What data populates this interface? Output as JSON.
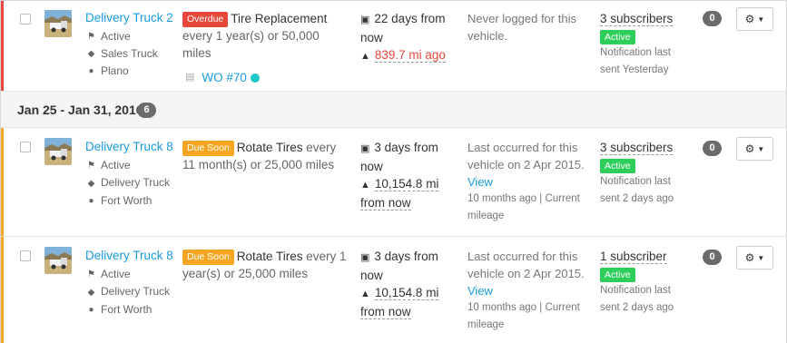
{
  "colors": {
    "overdue": "#e8473b",
    "due_soon": "#f5a623",
    "active": "#2dcf5a",
    "link": "#1a9be0"
  },
  "rows": [
    {
      "vehicle": {
        "name": "Delivery Truck 2",
        "status": "Active",
        "group": "Sales Truck",
        "location": "Plano"
      },
      "service": {
        "badge": "Overdue",
        "task": "Tire Replacement",
        "interval": "every 1 year(s) or 50,000 miles",
        "wo_label": "WO #70"
      },
      "due": {
        "time": "22 days from now",
        "meter": "839.7 mi ago"
      },
      "last": {
        "text": "Never logged for this vehicle.",
        "link": "",
        "note": ""
      },
      "subscribers": {
        "count": "3 subscribers",
        "status": "Active",
        "note": "Notification last sent Yesterday"
      },
      "comments": "0"
    },
    {
      "vehicle": {
        "name": "Delivery Truck 8",
        "status": "Active",
        "group": "Delivery Truck",
        "location": "Fort Worth"
      },
      "service": {
        "badge": "Due Soon",
        "task": "Rotate Tires",
        "interval": "every 11 month(s) or 25,000 miles"
      },
      "due": {
        "time": "3 days from now",
        "meter": "10,154.8 mi from now"
      },
      "last": {
        "text": "Last occurred for this vehicle on 2 Apr 2015.",
        "link": "View",
        "note": "10 months ago | Current mileage"
      },
      "subscribers": {
        "count": "3 subscribers",
        "status": "Active",
        "note": "Notification last sent 2 days ago"
      },
      "comments": "0"
    },
    {
      "vehicle": {
        "name": "Delivery Truck 8",
        "status": "Active",
        "group": "Delivery Truck",
        "location": "Fort Worth"
      },
      "service": {
        "badge": "Due Soon",
        "task": "Rotate Tires",
        "interval": "every 1 year(s) or 25,000 miles"
      },
      "due": {
        "time": "3 days from now",
        "meter": "10,154.8 mi from now"
      },
      "last": {
        "text": "Last occurred for this vehicle on 2 Apr 2015.",
        "link": "View",
        "note": "10 months ago | Current mileage"
      },
      "subscribers": {
        "count": "1 subscriber",
        "status": "Active",
        "note": "Notification last sent 2 days ago"
      },
      "comments": "0"
    }
  ],
  "group_header": {
    "label": "Jan 25 - Jan 31, 2016",
    "count": "6"
  }
}
